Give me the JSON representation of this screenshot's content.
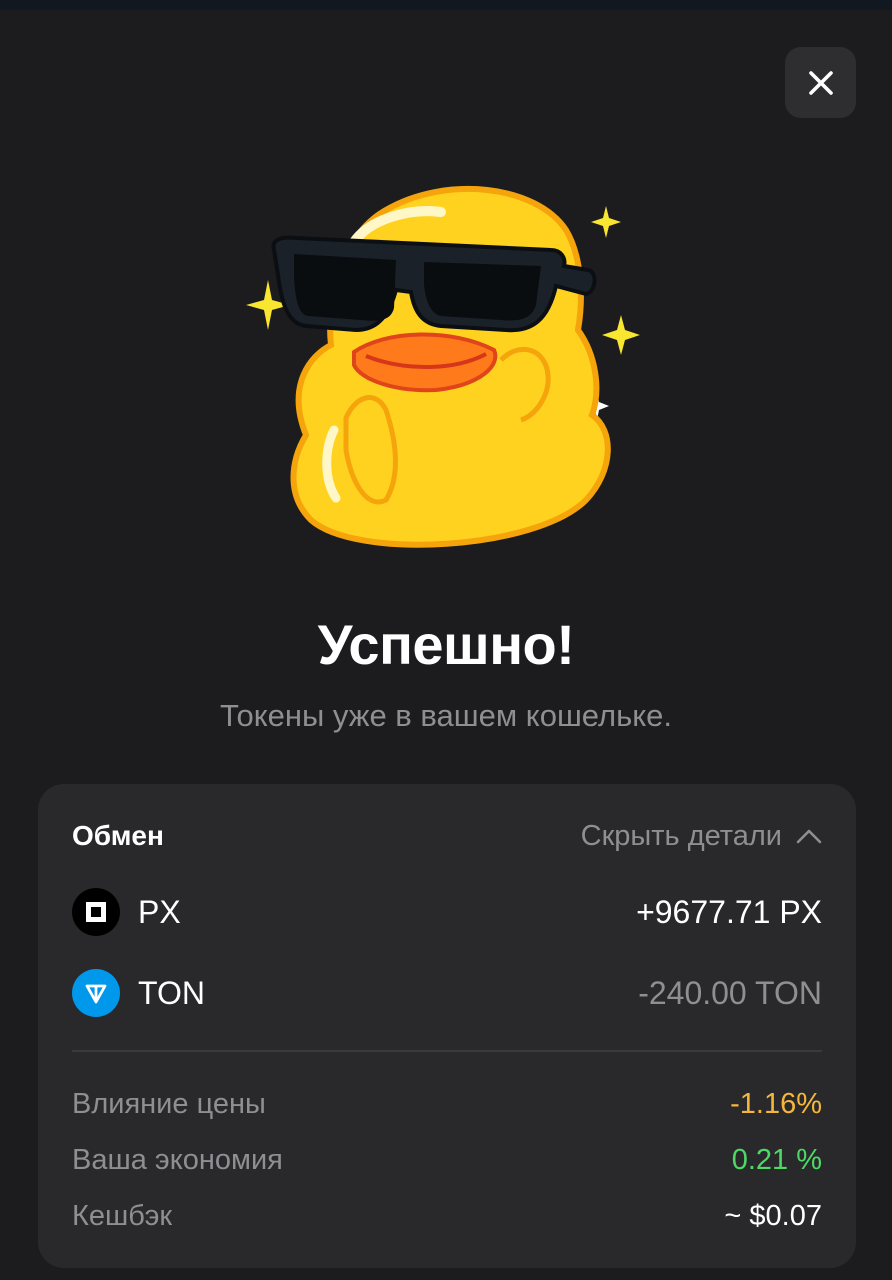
{
  "header": {
    "close_icon": "close-icon"
  },
  "sticker": {
    "name": "duck-sunglasses-sticker"
  },
  "title": "Успешно!",
  "subtitle": "Токены уже в вашем кошельке.",
  "swap_card": {
    "label": "Обмен",
    "toggle_label": "Скрыть детали",
    "toggle_icon": "chevron-up-icon",
    "tokens": [
      {
        "name": "PX",
        "amount": "+9677.71 PX",
        "icon": "px-token-icon",
        "amount_color": "#ffffff"
      },
      {
        "name": "TON",
        "amount": "-240.00 TON",
        "icon": "ton-token-icon",
        "amount_color": "#8e8e93"
      }
    ],
    "details": [
      {
        "label": "Влияние цены",
        "value": "-1.16%",
        "color": "#f5b73b"
      },
      {
        "label": "Ваша экономия",
        "value": "0.21 %",
        "color": "#4cd964"
      },
      {
        "label": "Кешбэк",
        "value": "~ $0.07",
        "color": "#ffffff"
      }
    ]
  },
  "colors": {
    "background": "#1c1c1e",
    "card": "#29292c",
    "ton_blue": "#0098ea",
    "muted_text": "#8e8e93"
  }
}
